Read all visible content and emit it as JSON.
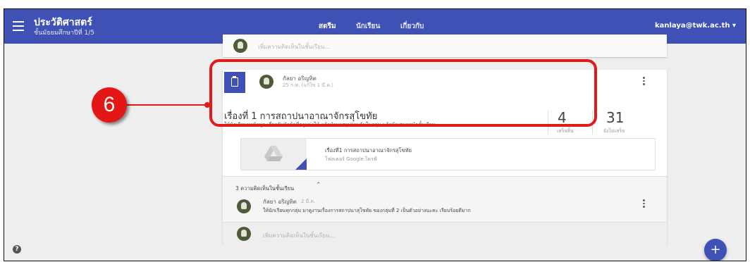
{
  "app": {
    "title": "ประวัติศาสตร์",
    "subtitle": "ชั้นมัธยมศึกษาปีที่ 1/5",
    "user": "kanlaya@twk.ac.th"
  },
  "tabs": [
    {
      "label": "สตรีม",
      "active": true
    },
    {
      "label": "นักเรียน",
      "active": false
    },
    {
      "label": "เกี่ยวกับ",
      "active": false
    }
  ],
  "top_card": {
    "comment_placeholder": "เพิ่มความคิดเห็นในชั้นเรียน..."
  },
  "assignment": {
    "author": "กัลยา อริญทิต",
    "date": "25 ก.พ. (แก้ไข 1 มี.ค.)",
    "title": "เรื่องที่ 1 การสถาปนาอาณาจักรสุโขทัย",
    "description": "ให้นักเรียนหาข้อมูล เกี่ยวกับหัวข้อที่ครูแบ่งให้ แล้วนำมาสรุปร่วมกันในกลุ่ม แล้วนำเสนอหน้าชั้นเรียน",
    "done_count": "4",
    "done_label": "เสร็จสิ้น",
    "not_done_count": "31",
    "not_done_label": "ยังไม่เสร็จ",
    "attachment_name": "เรื่องที่1 การสถาปนาอาณาจักรสุโขทัย",
    "attachment_type": "โฟลเดอร์ Google ไดรฟ์"
  },
  "comments": {
    "count_label": "3 ความคิดเห็นในชั้นเรียน",
    "items": [
      {
        "author": "กัลยา อริญทิต",
        "date": "2 มี.ค.",
        "text": "ให้นักเรียนทุกกลุ่ม มาดูงานเรื่องการสถาปนาสุโขทัย ของกลุ่มที่ 2 เป็นตัวอย่างนะคะ เรียบร้อยดีมาก"
      }
    ],
    "input_placeholder": "เพิ่มความคิดเห็นในชั้นเรียน..."
  },
  "annotation": {
    "number": "6"
  },
  "fab": {
    "symbol": "+"
  },
  "help": {
    "symbol": "?"
  },
  "colors": {
    "appbar": "#3f51b5",
    "highlight": "#e11a1a",
    "background": "#eeeeee"
  }
}
